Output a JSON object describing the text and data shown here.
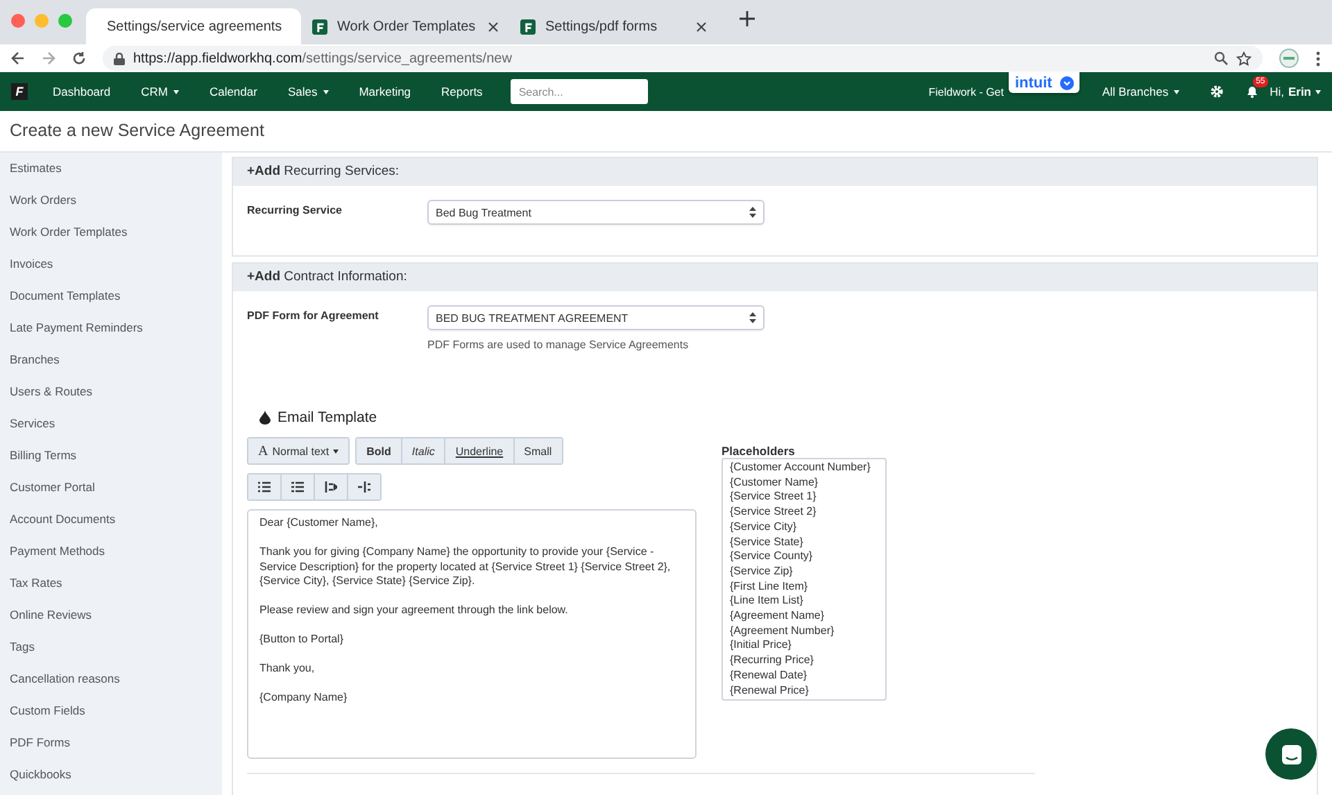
{
  "browser": {
    "tabs": [
      {
        "title": "Settings/service agreements",
        "selected": true
      },
      {
        "title": "Work Order Templates",
        "selected": false
      },
      {
        "title": "Settings/pdf forms",
        "selected": false
      }
    ],
    "url": {
      "host": "https://app.fieldworkhq.com",
      "path": "/settings/service_agreements/new"
    }
  },
  "navbar": {
    "logo": "F",
    "items": [
      {
        "label": "Dashboard",
        "dropdown": false
      },
      {
        "label": "CRM",
        "dropdown": true
      },
      {
        "label": "Calendar",
        "dropdown": false
      },
      {
        "label": "Sales",
        "dropdown": true
      },
      {
        "label": "Marketing",
        "dropdown": false
      },
      {
        "label": "Reports",
        "dropdown": false
      }
    ],
    "search": {
      "placeholder": "Search..."
    },
    "account_text": "Fieldwork - Get",
    "intuit_badge": "intuit",
    "branches": "All Branches",
    "notifications": "55",
    "greeting": "Hi,",
    "user": "Erin"
  },
  "page_title": "Create a new Service Agreement",
  "sidebar": {
    "items": [
      "Estimates",
      "Work Orders",
      "Work Order Templates",
      "Invoices",
      "Document Templates",
      "Late Payment Reminders",
      "Branches",
      "Users & Routes",
      "Services",
      "Billing Terms",
      "Customer Portal",
      "Account Documents",
      "Payment Methods",
      "Tax Rates",
      "Online Reviews",
      "Tags",
      "Cancellation reasons",
      "Custom Fields",
      "PDF Forms",
      "Quickbooks"
    ]
  },
  "recurring_section": {
    "add": "+Add",
    "title": "Recurring Services:",
    "field_label": "Recurring Service",
    "value": "Bed Bug Treatment"
  },
  "contract_section": {
    "add": "+Add",
    "title": "Contract Information:",
    "field_label": "PDF Form for Agreement",
    "value": "BED BUG TREATMENT AGREEMENT",
    "help": "PDF Forms are used to manage Service Agreements"
  },
  "email_template": {
    "title": "Email Template",
    "style_icon": "A",
    "style_dropdown": "Normal text",
    "format_buttons": [
      {
        "label": "Bold",
        "kind": "bold"
      },
      {
        "label": "Italic",
        "kind": "italic"
      },
      {
        "label": "Underline",
        "kind": "underline"
      },
      {
        "label": "Small",
        "kind": "small"
      }
    ],
    "body": [
      "Dear {Customer Name},",
      "Thank you for giving {Company Name} the opportunity to provide your {Service - Service Description} for the property located at {Service Street 1} {Service Street 2}, {Service City}, {Service State} {Service Zip}.",
      "Please review and sign your agreement through the link below.",
      "{Button to Portal}",
      "Thank you,",
      "{Company Name}"
    ]
  },
  "placeholders": {
    "title": "Placeholders",
    "items": [
      "{Customer Account Number}",
      "{Customer Name}",
      "{Service Street 1}",
      "{Service Street 2}",
      "{Service City}",
      "{Service State}",
      "{Service County}",
      "{Service Zip}",
      "{First Line Item}",
      "{Line Item List}",
      "{Agreement Name}",
      "{Agreement Number}",
      "{Initial Price}",
      "{Recurring Price}",
      "{Renewal Date}",
      "{Renewal Price}"
    ]
  }
}
